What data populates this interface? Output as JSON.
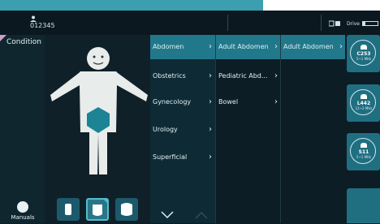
{
  "header": {
    "patient_id": "012345",
    "drive_label": "Drive",
    "drive_fill": 0.15
  },
  "sidebar": {
    "condition_label": "Condition",
    "manuals_label": "Manuals"
  },
  "probes": [
    "probe-linear",
    "probe-convex",
    "probe-curved"
  ],
  "menu": {
    "col1": [
      {
        "label": "Abdomen",
        "selected": true
      },
      {
        "label": "Obstetrics"
      },
      {
        "label": "Gynecology"
      },
      {
        "label": "Urology"
      },
      {
        "label": "Superficial"
      }
    ],
    "col2": [
      {
        "label": "Adult Abdomen",
        "selected": true
      },
      {
        "label": "Pediatric Abd..."
      },
      {
        "label": "Bowel"
      }
    ],
    "col3": [
      {
        "label": "Adult Abdomen",
        "selected": true
      }
    ]
  },
  "transducers": [
    {
      "name": "C253",
      "freq": "5~1 MHz"
    },
    {
      "name": "L442",
      "freq": "12~2 MHz"
    },
    {
      "name": "S11",
      "freq": "5~1 MHz"
    }
  ],
  "colors": {
    "accent": "#22788b",
    "highlight": "#2bb6c5"
  }
}
